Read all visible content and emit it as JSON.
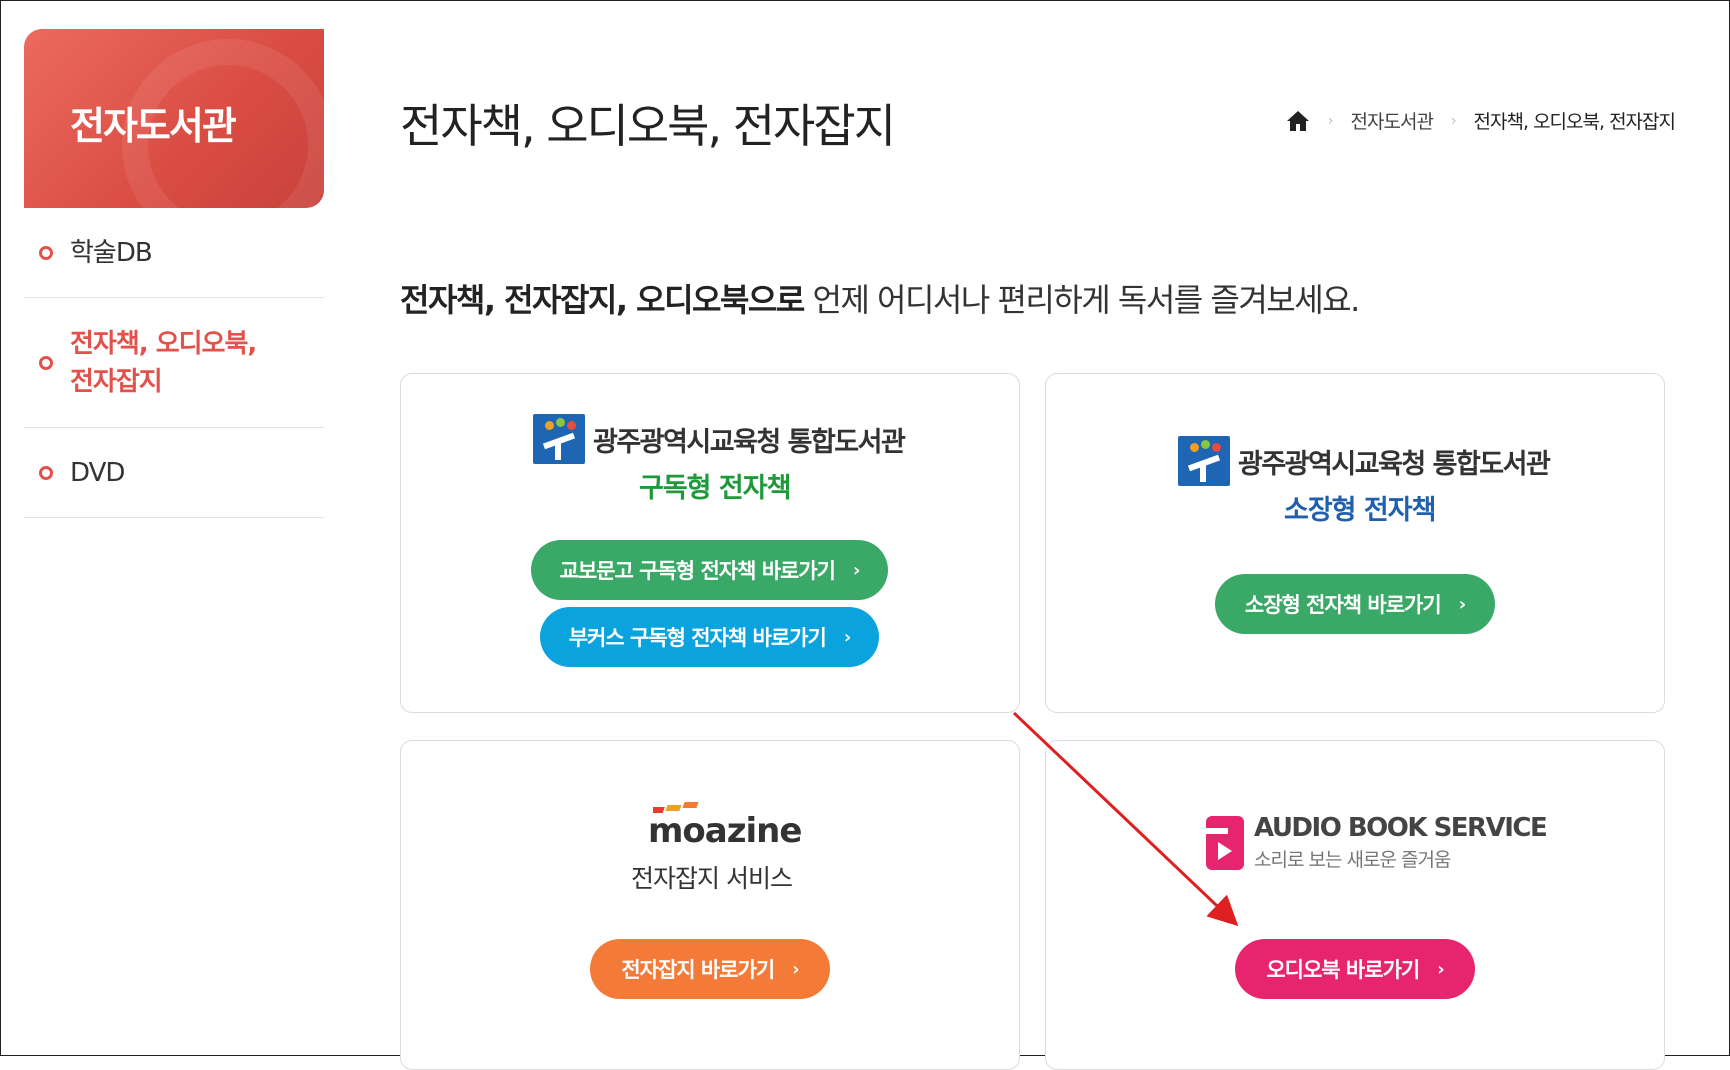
{
  "sidebar": {
    "title": "전자도서관",
    "items": [
      {
        "label": "학술DB",
        "active": false
      },
      {
        "label": "전자책, 오디오북,\n전자잡지",
        "label_line1": "전자책, 오디오북,",
        "label_line2": "전자잡지",
        "active": true
      },
      {
        "label": "DVD",
        "active": false
      }
    ]
  },
  "header": {
    "title": "전자책, 오디오북, 전자잡지",
    "breadcrumb": [
      "전자도서관",
      "전자책, 오디오북, 전자잡지"
    ]
  },
  "intro": {
    "bold": "전자책, 전자잡지, 오디오북으로",
    "rest": " 언제 어디서나 편리하게 독서를 즐겨보세요."
  },
  "cards": {
    "subscription": {
      "library_name": "광주광역시교육청 통합도서관",
      "subtitle": "구독형 전자책",
      "buttons": [
        "교보문고 구독형 전자책 바로가기",
        "부커스 구독형 전자책 바로가기"
      ]
    },
    "owned": {
      "library_name": "광주광역시교육청 통합도서관",
      "subtitle": "소장형 전자책",
      "buttons": [
        "소장형 전자책 바로가기"
      ]
    },
    "magazine": {
      "logo_text": "moazine",
      "subtitle": "전자잡지 서비스",
      "buttons": [
        "전자잡지 바로가기"
      ]
    },
    "audiobook": {
      "logo_title": "AUDIO BOOK SERVICE",
      "logo_sub": "소리로 보는 새로운 즐거움",
      "buttons": [
        "오디오북 바로가기"
      ]
    }
  },
  "icons": {
    "home": "home-icon",
    "chevron": "chevron-right-icon",
    "bullet": "circle-bullet-icon"
  },
  "colors": {
    "brand_red": "#e2524a",
    "green": "#3aa866",
    "blue": "#0aa3dd",
    "orange": "#f47a38",
    "pink": "#e6256e",
    "annotation_arrow": "#e02020"
  }
}
